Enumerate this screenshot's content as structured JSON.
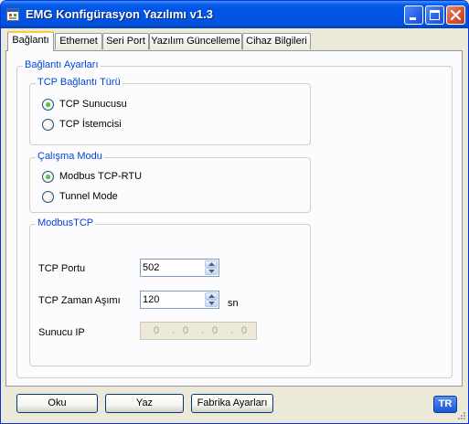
{
  "window": {
    "title": "EMG Konfigürasyon Yazılımı v1.3"
  },
  "tabs": [
    {
      "label": "Bağlantı",
      "selected": true
    },
    {
      "label": "Ethernet",
      "selected": false
    },
    {
      "label": "Seri Port",
      "selected": false
    },
    {
      "label": "Yazılım Güncelleme",
      "selected": false
    },
    {
      "label": "Cihaz Bilgileri",
      "selected": false
    }
  ],
  "connection_settings": {
    "title": "Bağlantı Ayarları",
    "tcp_type": {
      "title": "TCP Bağlantı Türü",
      "options": [
        {
          "label": "TCP Sunucusu",
          "checked": true
        },
        {
          "label": "TCP İstemcisi",
          "checked": false
        }
      ]
    },
    "operating_mode": {
      "title": "Çalışma Modu",
      "options": [
        {
          "label": "Modbus TCP-RTU",
          "checked": true
        },
        {
          "label": "Tunnel Mode",
          "checked": false
        }
      ]
    },
    "modbus_tcp": {
      "title": "ModbusTCP",
      "tcp_port_label": "TCP Portu",
      "tcp_port_value": "502",
      "tcp_timeout_label": "TCP Zaman Aşımı",
      "tcp_timeout_value": "120",
      "timeout_unit": "sn",
      "server_ip_label": "Sunucu IP",
      "server_ip": [
        "0",
        "0",
        "0",
        "0"
      ],
      "server_ip_separator": "."
    }
  },
  "buttons": {
    "read": "Oku",
    "write": "Yaz",
    "factory": "Fabrika Ayarları",
    "language": "TR"
  },
  "colors": {
    "group_title": "#0046d5",
    "titlebar": "#0055e5",
    "radio_dot": "#21a121"
  }
}
